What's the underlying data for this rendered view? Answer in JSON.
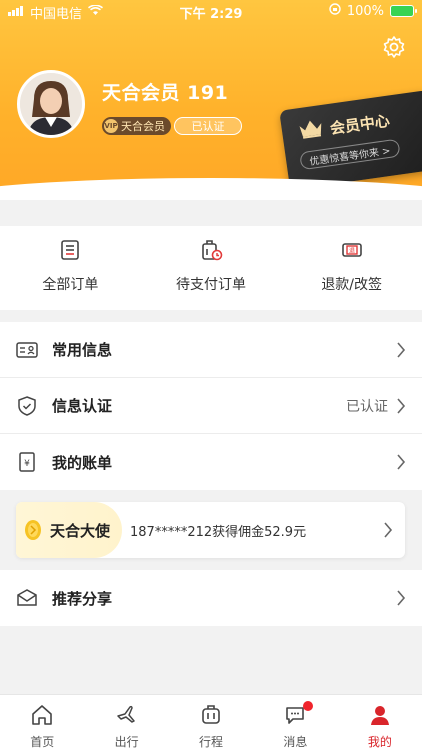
{
  "status_bar": {
    "carrier": "中国电信",
    "time": "下午 2:29",
    "battery": "100%"
  },
  "profile": {
    "name": "天合会员 191",
    "vip_level": "天合会员",
    "vip_badge_icon": "VIP",
    "verified": "已认证"
  },
  "member_card": {
    "title": "会员中心",
    "subtitle": "优惠惊喜等你来 >"
  },
  "orders": [
    {
      "label": "全部订单",
      "icon": "order-list-icon"
    },
    {
      "label": "待支付订单",
      "icon": "pending-payment-icon"
    },
    {
      "label": "退款/改签",
      "icon": "refund-ticket-icon"
    }
  ],
  "menu": [
    {
      "label": "常用信息",
      "icon": "id-card-icon",
      "value": ""
    },
    {
      "label": "信息认证",
      "icon": "shield-icon",
      "value": "已认证"
    },
    {
      "label": "我的账单",
      "icon": "bill-icon",
      "value": ""
    }
  ],
  "ambassador": {
    "title": "天合大使",
    "text": "187*****212获得佣金52.9元"
  },
  "share": {
    "label": "推荐分享",
    "icon": "envelope-icon"
  },
  "tabbar": [
    {
      "label": "首页",
      "icon": "home-icon"
    },
    {
      "label": "出行",
      "icon": "plane-icon"
    },
    {
      "label": "行程",
      "icon": "luggage-icon"
    },
    {
      "label": "消息",
      "icon": "chat-icon"
    },
    {
      "label": "我的",
      "icon": "user-icon"
    }
  ],
  "colors": {
    "header": "#ffb22b",
    "accent": "#d9252b",
    "card": "#1e1e1e"
  }
}
